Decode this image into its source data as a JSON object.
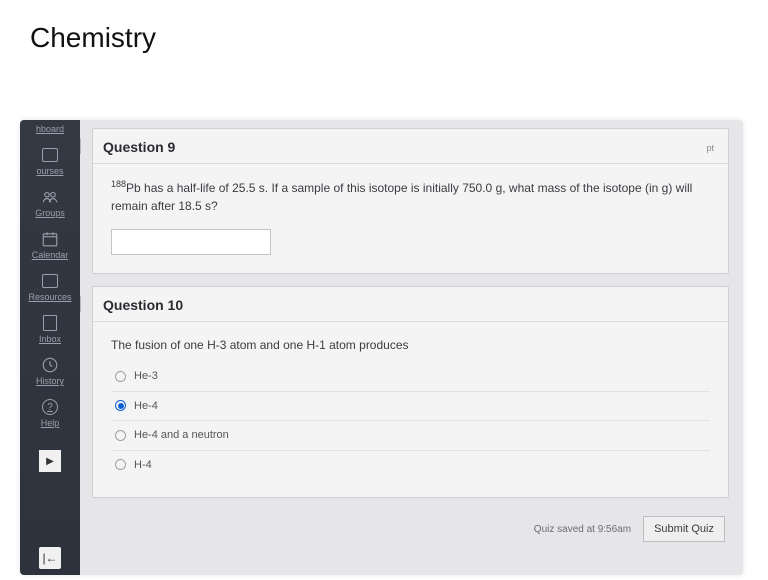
{
  "page_title": "Chemistry",
  "sidebar": {
    "items": [
      {
        "label": "hboard"
      },
      {
        "label": "ourses"
      },
      {
        "label": "Groups"
      },
      {
        "label": "Calendar"
      },
      {
        "label": "Resources"
      },
      {
        "label": "Inbox"
      },
      {
        "label": "History"
      },
      {
        "label": "Help"
      }
    ],
    "expand": "|←"
  },
  "q9": {
    "title": "Question 9",
    "pts": "pt",
    "text_pre": "188",
    "text": "Pb has a half-life of 25.5 s.  If a sample of this isotope is initially 750.0 g, what mass of the isotope (in g) will remain after 18.5 s?",
    "answer": ""
  },
  "q10": {
    "title": "Question 10",
    "text": "The fusion of one H-3 atom and one H-1 atom produces",
    "options": [
      {
        "label": "He-3",
        "selected": false
      },
      {
        "label": "He-4",
        "selected": true
      },
      {
        "label": "He-4 and a neutron",
        "selected": false
      },
      {
        "label": "H-4",
        "selected": false
      }
    ]
  },
  "footer": {
    "saved": "Quiz saved at 9:56am",
    "submit": "Submit Quiz"
  }
}
